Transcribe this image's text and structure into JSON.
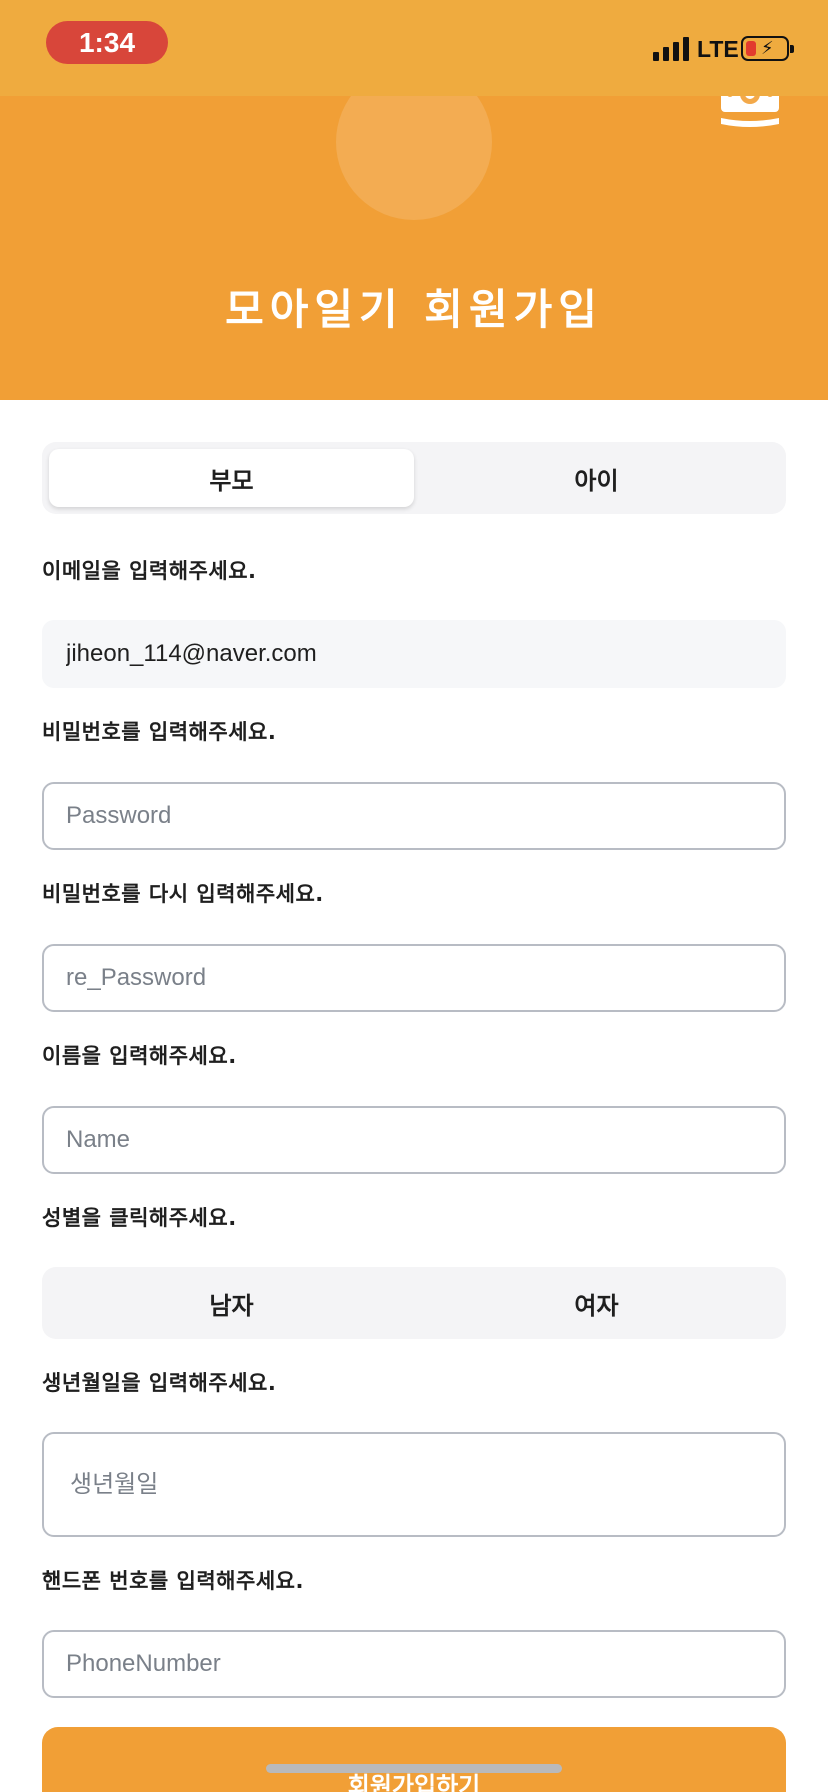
{
  "status_bar": {
    "time": "1:34",
    "network": "LTE"
  },
  "header": {
    "title": "모아일기 회원가입",
    "logo_icon": "money-bill-icon"
  },
  "role_tabs": [
    {
      "label": "부모",
      "selected": true
    },
    {
      "label": "아이",
      "selected": false
    }
  ],
  "form": {
    "email_label": "이메일을 입력해주세요.",
    "email_value": "jiheon_114@naver.com",
    "password_label": "비밀번호를 입력해주세요.",
    "password_placeholder": "Password",
    "repassword_label": "비밀번호를 다시 입력해주세요.",
    "repassword_placeholder": "re_Password",
    "name_label": "이름을 입력해주세요.",
    "name_placeholder": "Name",
    "gender_label": "성별을 클릭해주세요.",
    "gender_options": [
      {
        "label": "남자"
      },
      {
        "label": "여자"
      }
    ],
    "birth_label": "생년월일을 입력해주세요.",
    "birth_placeholder": "생년월일",
    "phone_label": "핸드폰 번호를 입력해주세요.",
    "phone_placeholder": "PhoneNumber",
    "submit_label": "회원가입하기"
  },
  "colors": {
    "status_bar": "#efab3f",
    "header": "#f19f36",
    "accent": "#f19f36",
    "time_pill": "#d8463a"
  }
}
